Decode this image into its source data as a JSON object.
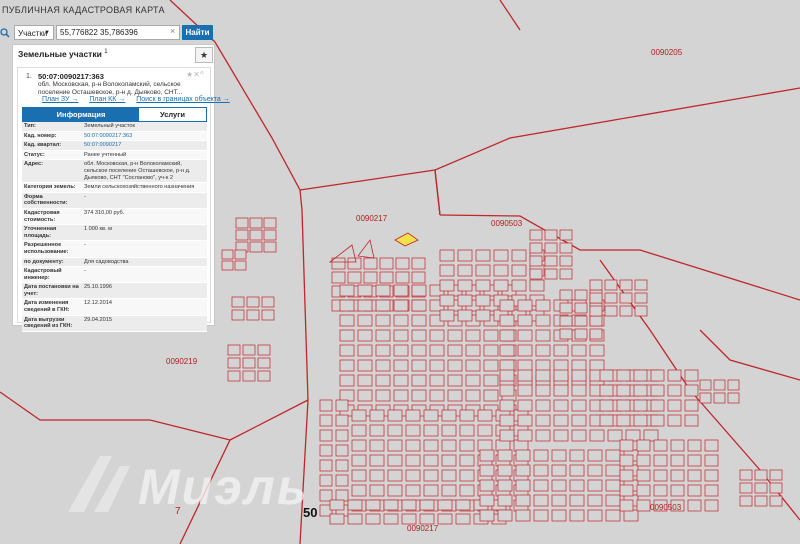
{
  "app": {
    "title": "ПУБЛИЧНАЯ КАДАСТРОВАЯ КАРТА"
  },
  "search": {
    "type_selected": "Участки",
    "value": "55,776822 35,786396",
    "button_label": "Найти"
  },
  "panel": {
    "title": "Земельные участки",
    "title_count": "1",
    "result_index": "1.",
    "result_id": "50:07:0090217:363",
    "result_address": "обл. Московская, р-н Волоколамский, сельское поселение Осташевское, р-н д. Дыяково, СНТ...",
    "links": [
      "План ЗУ →",
      "План КК →",
      "Поиск в границах объекта →"
    ],
    "tabs": [
      "Информация",
      "Услуги"
    ],
    "rows": [
      {
        "k": "Тип:",
        "v": "Земельный участок",
        "link": false
      },
      {
        "k": "Кад. номер:",
        "v": "50:07:0090217:363",
        "link": true
      },
      {
        "k": "Кад. квартал:",
        "v": "50:07:0090217",
        "link": true
      },
      {
        "k": "Статус:",
        "v": "Ранее учтенный",
        "link": false
      },
      {
        "k": "Адрес:",
        "v": "обл. Московская, р-н Волоколамский, сельское поселение Осташевское, р-н д. Дыяково, СНТ \"Сосланово\", уч-к 2",
        "link": false
      },
      {
        "k": "Категория земель:",
        "v": "Земли сельскохозяйственного назначения",
        "link": false
      },
      {
        "k": "Форма собственности:",
        "v": "-",
        "link": false
      },
      {
        "k": "Кадастровая стоимость:",
        "v": "374 310,00 руб.",
        "link": false
      },
      {
        "k": "Уточненная площадь:",
        "v": "1 000 кв. м",
        "link": false
      },
      {
        "k": "Разрешенное использование:",
        "v": "-",
        "link": false
      },
      {
        "k": "по документу:",
        "v": "Для садоводства",
        "link": false
      },
      {
        "k": "Кадастровый инженер:",
        "v": "-",
        "link": false
      },
      {
        "k": "Дата постановки на учет:",
        "v": "25.10.1996",
        "link": false
      },
      {
        "k": "Дата изменения сведений в ГКН:",
        "v": "12.12.2014",
        "link": false
      },
      {
        "k": "Дата выгрузки сведений из ГКН:",
        "v": "29.04.2015",
        "link": false
      }
    ]
  },
  "map": {
    "labels": [
      {
        "t": "0090205"
      },
      {
        "t": "0090217"
      },
      {
        "t": "0090503"
      },
      {
        "t": "0090219"
      },
      {
        "t": "0090217"
      },
      {
        "t": "0090503"
      }
    ],
    "big_numbers": [
      "50",
      "7"
    ],
    "watermark": "Миэль",
    "highlight_color": "#f4e04a",
    "boundary_color": "#c0262c"
  }
}
